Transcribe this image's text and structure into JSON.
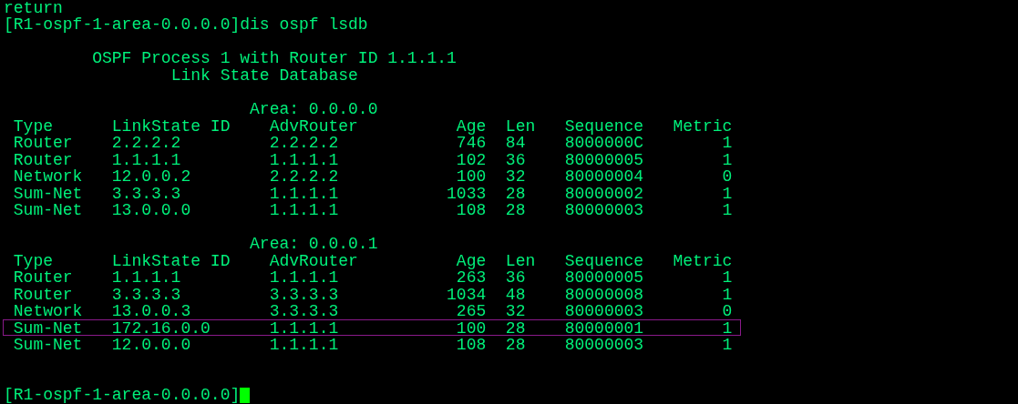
{
  "history": [
    "return",
    "[R1-ospf-1-area-0.0.0.0]dis ospf lsdb"
  ],
  "header": {
    "title": "OSPF Process 1 with Router ID 1.1.1.1",
    "subtitle": "Link State Database"
  },
  "areas": [
    {
      "label": "Area: 0.0.0.0",
      "columns": [
        "Type",
        "LinkState ID",
        "AdvRouter",
        "Age",
        "Len",
        "Sequence",
        "Metric"
      ],
      "rows": [
        {
          "cells": [
            "Router",
            "2.2.2.2",
            "2.2.2.2",
            "746",
            "84",
            "8000000C",
            "1"
          ],
          "highlighted": false
        },
        {
          "cells": [
            "Router",
            "1.1.1.1",
            "1.1.1.1",
            "102",
            "36",
            "80000005",
            "1"
          ],
          "highlighted": false
        },
        {
          "cells": [
            "Network",
            "12.0.0.2",
            "2.2.2.2",
            "100",
            "32",
            "80000004",
            "0"
          ],
          "highlighted": false
        },
        {
          "cells": [
            "Sum-Net",
            "3.3.3.3",
            "1.1.1.1",
            "1033",
            "28",
            "80000002",
            "1"
          ],
          "highlighted": false
        },
        {
          "cells": [
            "Sum-Net",
            "13.0.0.0",
            "1.1.1.1",
            "108",
            "28",
            "80000003",
            "1"
          ],
          "highlighted": false
        }
      ]
    },
    {
      "label": "Area: 0.0.0.1",
      "columns": [
        "Type",
        "LinkState ID",
        "AdvRouter",
        "Age",
        "Len",
        "Sequence",
        "Metric"
      ],
      "rows": [
        {
          "cells": [
            "Router",
            "1.1.1.1",
            "1.1.1.1",
            "263",
            "36",
            "80000005",
            "1"
          ],
          "highlighted": false
        },
        {
          "cells": [
            "Router",
            "3.3.3.3",
            "3.3.3.3",
            "1034",
            "48",
            "80000008",
            "1"
          ],
          "highlighted": false
        },
        {
          "cells": [
            "Network",
            "13.0.0.3",
            "3.3.3.3",
            "265",
            "32",
            "80000003",
            "0"
          ],
          "highlighted": false
        },
        {
          "cells": [
            "Sum-Net",
            "172.16.0.0",
            "1.1.1.1",
            "100",
            "28",
            "80000001",
            "1"
          ],
          "highlighted": true
        },
        {
          "cells": [
            "Sum-Net",
            "12.0.0.0",
            "1.1.1.1",
            "108",
            "28",
            "80000003",
            "1"
          ],
          "highlighted": false
        }
      ]
    }
  ],
  "prompt": "[R1-ospf-1-area-0.0.0.0]"
}
